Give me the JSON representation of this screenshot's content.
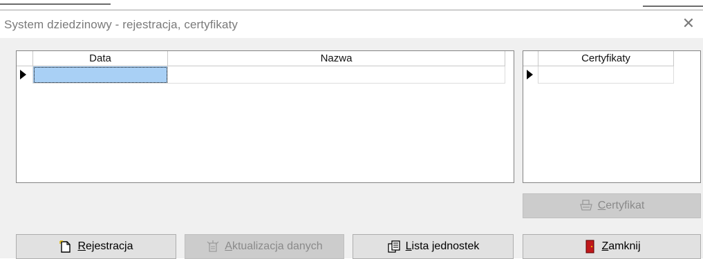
{
  "window": {
    "title": "System dziedzinowy - rejestracja, certyfikaty",
    "close_glyph": "✕"
  },
  "main_grid": {
    "columns": [
      "Data",
      "Nazwa"
    ],
    "rows": [
      {
        "data": "",
        "nazwa": ""
      }
    ]
  },
  "cert_grid": {
    "columns": [
      "Certyfikaty"
    ],
    "rows": [
      {
        "certyfikaty": ""
      }
    ]
  },
  "buttons": {
    "certyfikat": {
      "accel": "C",
      "rest": "ertyfikat",
      "enabled": false,
      "icon": "printer-icon"
    },
    "rejestracja": {
      "accel": "R",
      "rest": "ejestracja",
      "enabled": true,
      "icon": "new-document-icon"
    },
    "aktualizacja": {
      "accel": "A",
      "rest": "ktualizacja danych",
      "enabled": false,
      "icon": "update-icon"
    },
    "lista": {
      "accel": "L",
      "rest": "ista jednostek",
      "enabled": true,
      "icon": "document-list-icon"
    },
    "zamknij": {
      "accel": "Z",
      "rest": "amknij",
      "enabled": true,
      "icon": "exit-door-icon"
    }
  },
  "colors": {
    "selection": "#a9d0f5",
    "button_face": "#e1e1e1",
    "disabled_text": "#8a8a8a",
    "door_red": "#c0181b"
  }
}
